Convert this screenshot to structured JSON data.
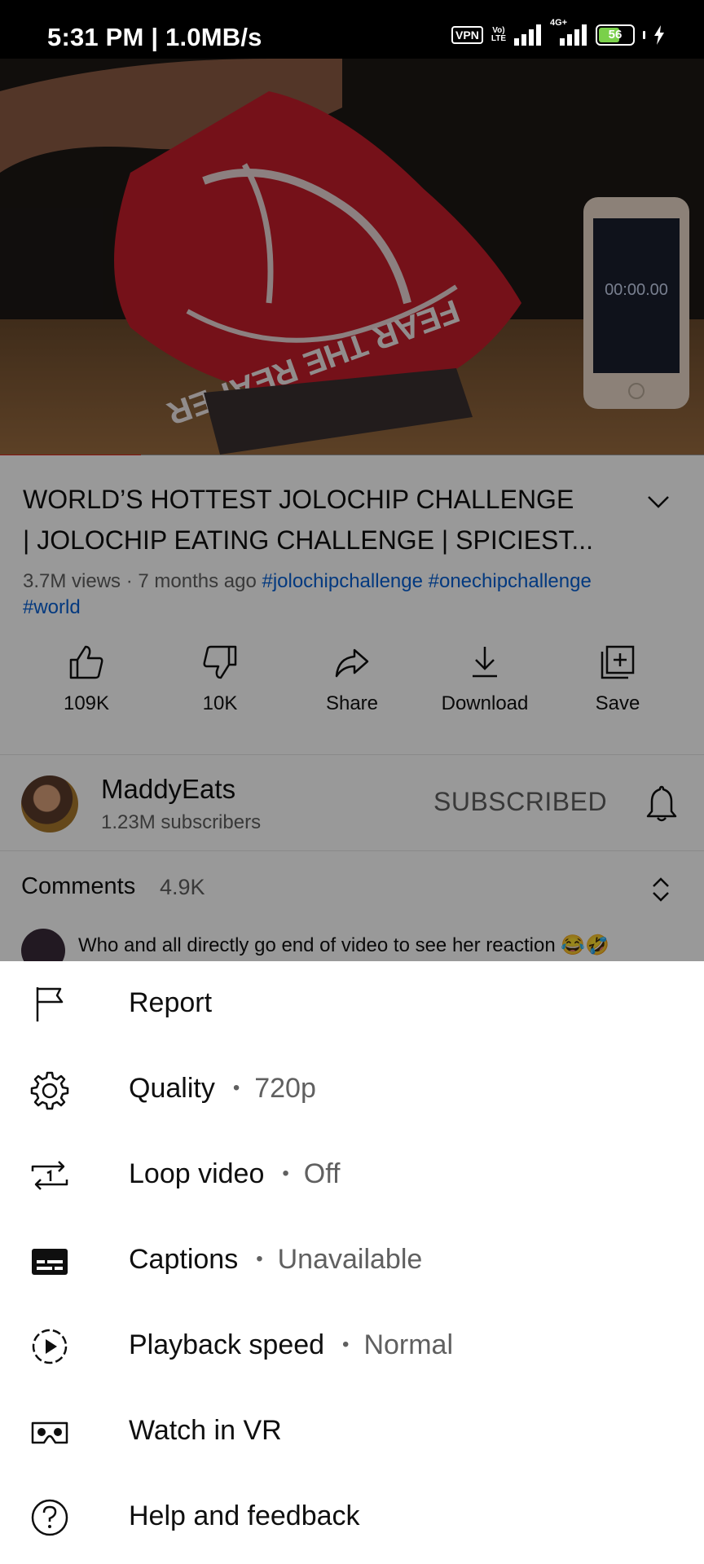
{
  "status_bar": {
    "time": "5:31 PM | 1.0MB/s",
    "vpn": "VPN",
    "volte_top": "Vo)",
    "volte_bottom": "LTE",
    "network_type": "4G+",
    "battery": "56"
  },
  "video": {
    "overlay_text": "FEAR THE REAPER",
    "stopwatch": "00:00.00"
  },
  "details": {
    "title_line1": "WORLD’S HOTTEST JOLOCHIP CHALLENGE",
    "title_line2": "| JOLOCHIP EATING CHALLENGE | SPICIEST...",
    "views_age": "3.7M views · 7 months ago ",
    "hashtag1": "#jolochipchallenge",
    "hashtag2": "#onechipchallenge",
    "hashtag3": "#world"
  },
  "actions": {
    "like": "109K",
    "dislike": "10K",
    "share": "Share",
    "download": "Download",
    "save": "Save"
  },
  "channel": {
    "name": "MaddyEats",
    "subscribers": "1.23M subscribers",
    "subscribe_state": "SUBSCRIBED"
  },
  "comments": {
    "label": "Comments",
    "count": "4.9K",
    "preview": "Who and all directly go end of video  to see her reaction 😂🤣"
  },
  "menu": {
    "report": "Report",
    "quality": "Quality",
    "quality_value": "720p",
    "loop": "Loop video",
    "loop_value": "Off",
    "captions": "Captions",
    "captions_value": "Unavailable",
    "playback": "Playback speed",
    "playback_value": "Normal",
    "vr": "Watch in VR",
    "help": "Help and feedback",
    "separator": "•"
  },
  "colors": {
    "hashtag": "#065fd4",
    "progress": "#e0211c",
    "sheet_background": "#ffffff"
  }
}
